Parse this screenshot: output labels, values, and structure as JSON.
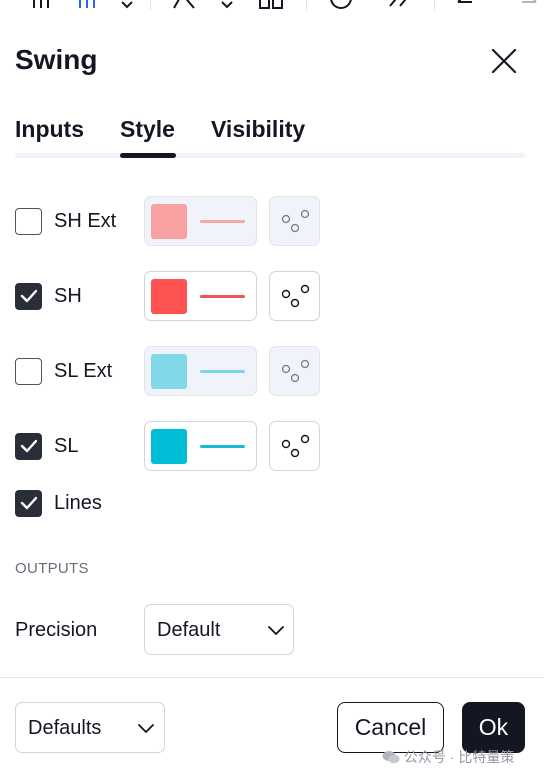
{
  "dialog": {
    "title": "Swing",
    "close_icon": "close-icon"
  },
  "tabs": [
    {
      "label": "Inputs",
      "active": false
    },
    {
      "label": "Style",
      "active": true
    },
    {
      "label": "Visibility",
      "active": false
    }
  ],
  "style_rows": [
    {
      "label": "SH Ext",
      "checked": false,
      "color": "#f7a1a3",
      "disabled": true
    },
    {
      "label": "SH",
      "checked": true,
      "color": "#ff5252",
      "disabled": false
    },
    {
      "label": "SL Ext",
      "checked": false,
      "color": "#80d8e8",
      "disabled": true
    },
    {
      "label": "SL",
      "checked": true,
      "color": "#00bcd4",
      "disabled": false
    },
    {
      "label": "Lines",
      "checked": true
    }
  ],
  "outputs": {
    "section_title": "OUTPUTS",
    "precision_label": "Precision",
    "precision_value": "Default"
  },
  "footer": {
    "defaults_label": "Defaults",
    "cancel_label": "Cancel",
    "ok_label": "Ok"
  },
  "watermark": "公众号 · 比特量策"
}
